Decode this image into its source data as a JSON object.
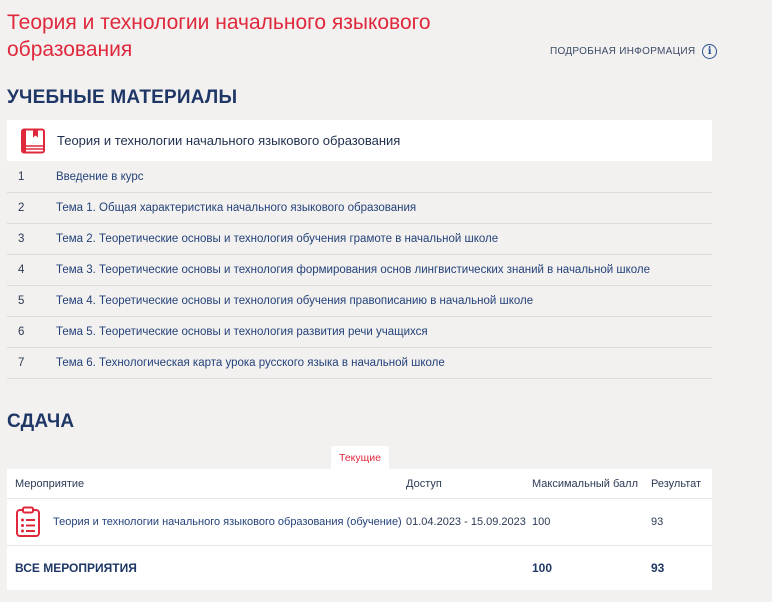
{
  "page": {
    "title": "Теория и технологии начального языкового образования",
    "more_info": "ПОДРОБНАЯ ИНФОРМАЦИЯ",
    "info_icon": "i"
  },
  "materials": {
    "heading": "УЧЕБНЫЕ МАТЕРИАЛЫ",
    "card_title": "Теория и технологии начального языкового образования",
    "card_icon": "book-icon",
    "items": [
      {
        "num": "1",
        "label": "Введение в курс"
      },
      {
        "num": "2",
        "label": "Тема 1. Общая характеристика начального языкового образования"
      },
      {
        "num": "3",
        "label": "Тема 2. Теоретические основы и технология обучения грамоте в начальной школе"
      },
      {
        "num": "4",
        "label": "Тема 3. Теоретические основы и технология формирования основ лингвистических знаний в начальной школе"
      },
      {
        "num": "5",
        "label": "Тема 4. Теоретические основы и технология обучения правописанию в начальной школе"
      },
      {
        "num": "6",
        "label": "Тема 5. Теоретические основы и технология развития речи учащихся"
      },
      {
        "num": "7",
        "label": "Тема 6. Технологическая карта урока русского языка в начальной школе"
      }
    ]
  },
  "submission": {
    "heading": "СДАЧА",
    "tab_current": "Текущие",
    "columns": {
      "event": "Мероприятие",
      "access": "Доступ",
      "max_score": "Максимальный балл",
      "result": "Результат"
    },
    "rows": [
      {
        "event": "Теория и технологии начального языкового образования (обучение)",
        "access": "01.04.2023 - 15.09.2023",
        "max_score": "100",
        "result": "93",
        "icon": "clipboard-icon"
      }
    ],
    "total": {
      "label": "ВСЕ МЕРОПРИЯТИЯ",
      "max_score": "100",
      "result": "93"
    }
  },
  "colors": {
    "accent": "#e0283d",
    "heading": "#1f3766",
    "link": "#24427a",
    "background": "#f2f1ef"
  }
}
